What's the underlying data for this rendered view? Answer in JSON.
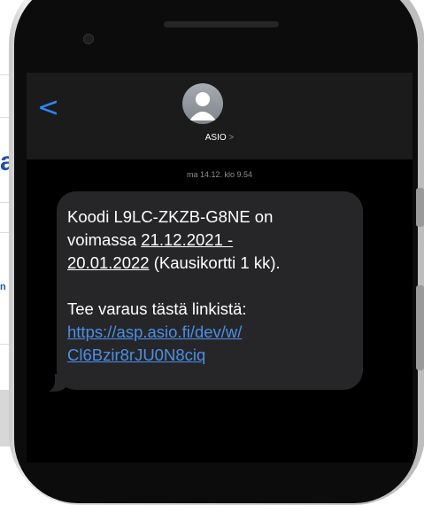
{
  "background_page": {
    "fragment_1": "a",
    "fragment_2": "n"
  },
  "conversation": {
    "contact_name": "ASIO",
    "contact_chevron": ">",
    "back_glyph": "<",
    "timestamp": "ma 14.12. klo 9.54"
  },
  "message": {
    "line1": "Koodi L9LC-ZKZB-G8NE on",
    "line2_prefix": "voimassa ",
    "line2_date": "21.12.2021 -",
    "line3_date": "20.01.2022",
    "line3_suffix": " (Kausikortti 1 kk).",
    "line4": "Tee varaus tästä linkistä:",
    "link_part1": "https://asp.asio.fi/dev/w/",
    "link_part2": "Cl6Bzir8rJU0N8ciq"
  },
  "colors": {
    "link": "#4a8fe7",
    "bubble": "#262628",
    "back_arrow": "#2f86ff"
  },
  "icons": {
    "back": "chevron-left-icon",
    "avatar": "person-avatar-icon"
  }
}
